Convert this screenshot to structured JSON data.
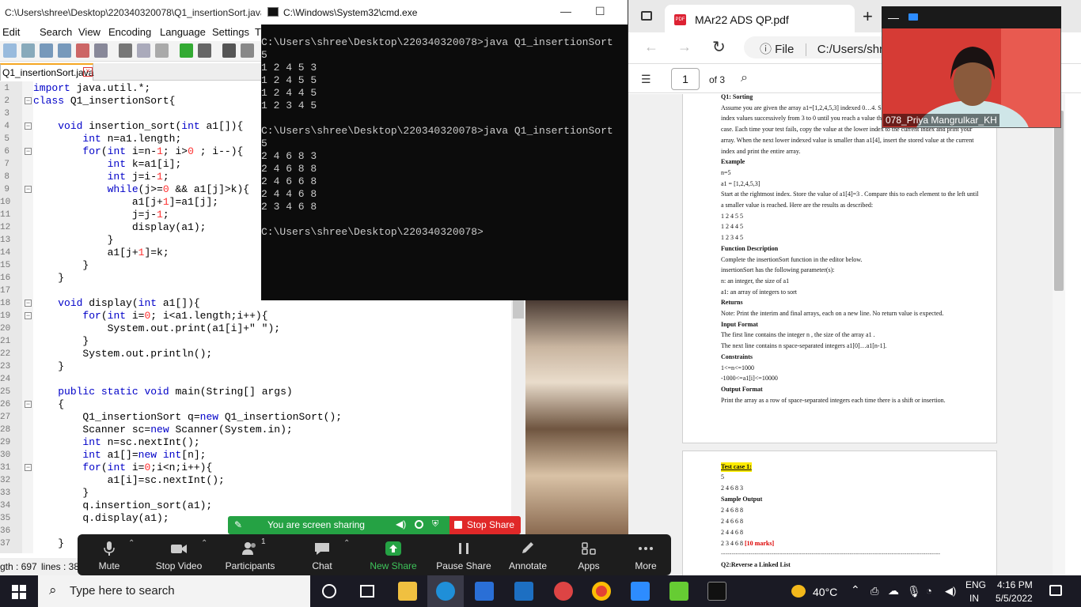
{
  "npp": {
    "title": "C:\\Users\\shree\\Desktop\\220340320078\\Q1_insertionSort.java",
    "menu": [
      "Edit",
      "Search",
      "View",
      "Encoding",
      "Language",
      "Settings",
      "T"
    ],
    "tab_label": "Q1_insertionSort.java",
    "line_numbers": [
      "1",
      "2",
      "3",
      "4",
      "5",
      "6",
      "7",
      "8",
      "9",
      "10",
      "11",
      "12",
      "13",
      "14",
      "15",
      "16",
      "17",
      "18",
      "19",
      "20",
      "21",
      "22",
      "23",
      "24",
      "25",
      "26",
      "27",
      "28",
      "29",
      "30",
      "31",
      "32",
      "33",
      "34",
      "35",
      "36",
      "37"
    ],
    "code": [
      "import java.util.*;",
      "class Q1_insertionSort{",
      "",
      "    void insertion_sort(int a1[]){",
      "        int n=a1.length;",
      "        for(int i=n-1; i>0 ; i--){",
      "            int k=a1[i];",
      "            int j=i-1;",
      "            while(j>=0 && a1[j]>k){",
      "                a1[j+1]=a1[j];",
      "                j=j-1;",
      "                display(a1);",
      "            }",
      "            a1[j+1]=k;",
      "        }",
      "    }",
      "",
      "    void display(int a1[]){",
      "        for(int i=0; i<a1.length;i++){",
      "            System.out.print(a1[i]+\" \");",
      "        }",
      "        System.out.println();",
      "    }",
      "",
      "    public static void main(String[] args)",
      "    {",
      "        Q1_insertionSort q=new Q1_insertionSort();",
      "        Scanner sc=new Scanner(System.in);",
      "        int n=sc.nextInt();",
      "        int a1[]=new int[n];",
      "        for(int i=0;i<n;i++){",
      "            a1[i]=sc.nextInt();",
      "        }",
      "        q.insertion_sort(a1);",
      "        q.display(a1);",
      "",
      "    }"
    ],
    "status_length": "gth : 697",
    "status_lines": "lines : 38"
  },
  "cmd": {
    "title": "C:\\Windows\\System32\\cmd.exe",
    "lines": [
      "C:\\Users\\shree\\Desktop\\220340320078>java Q1_insertionSort",
      "5",
      "1 2 4 5 3",
      "1 2 4 5 5",
      "1 2 4 4 5",
      "1 2 3 4 5",
      "",
      "C:\\Users\\shree\\Desktop\\220340320078>java Q1_insertionSort",
      "5",
      "2 4 6 8 3",
      "2 4 6 8 8",
      "2 4 6 6 8",
      "2 4 4 6 8",
      "2 3 4 6 8",
      "",
      "C:\\Users\\shree\\Desktop\\220340320078>"
    ]
  },
  "browser": {
    "tab_title": "MAr22 ADS QP.pdf",
    "pdf_badge": "PDF",
    "address_prefix": "File",
    "address": "C:/Users/shree",
    "page_current": "1",
    "page_total": "of 3"
  },
  "pdf_page1": [
    {
      "t": "Q1: Sorting",
      "b": true
    },
    {
      "t": "Assume you are given the array a1=[1,2,4,5,3] indexed 0…4. S",
      "b": false
    },
    {
      "t": "index values successively from 3 to 0 until you reach a value th",
      "b": false
    },
    {
      "t": "case. Each time your test fails, copy the value at the lower index to the current index and print your",
      "b": false
    },
    {
      "t": "array. When the next lower indexed value is smaller than a1[4], insert the stored value at the current",
      "b": false
    },
    {
      "t": "index and print the entire array.",
      "b": false
    },
    {
      "t": "Example",
      "b": true
    },
    {
      "t": "n=5",
      "b": false
    },
    {
      "t": "a1 = [1,2,4,5,3]",
      "b": false
    },
    {
      "t": "Start at the rightmost index. Store the value of a1[4]=3 . Compare this to each element to the left until",
      "b": false
    },
    {
      "t": "a smaller value is reached. Here are the results as described:",
      "b": false
    },
    {
      "t": "1 2 4 5 5",
      "b": false
    },
    {
      "t": "1 2 4 4 5",
      "b": false
    },
    {
      "t": "1 2 3 4 5",
      "b": false
    },
    {
      "t": "Function Description",
      "b": true
    },
    {
      "t": "Complete the insertionSort function in the editor below.",
      "b": false
    },
    {
      "t": "insertionSort has the following parameter(s):",
      "b": false
    },
    {
      "t": "n: an integer, the size of a1",
      "b": false
    },
    {
      "t": "a1: an array of integers to sort",
      "b": false
    },
    {
      "t": "Returns",
      "b": true
    },
    {
      "t": "Note: Print the interim and final arrays, each on a new line. No return value is expected.",
      "b": false
    },
    {
      "t": "Input Format",
      "b": true
    },
    {
      "t": "The first line contains the integer n , the size of the array a1 .",
      "b": false
    },
    {
      "t": "The next line contains n space-separated integers a1[0]…a1[n-1].",
      "b": false
    },
    {
      "t": "Constraints",
      "b": true
    },
    {
      "t": "1<=n<=1000",
      "b": false
    },
    {
      "t": "-1000<=a1[i]<=10000",
      "b": false
    },
    {
      "t": "Output Format",
      "b": true
    },
    {
      "t": "Print the array as a row of space-separated integers each time there is a shift or insertion.",
      "b": false
    }
  ],
  "pdf_page2": {
    "testcase": "Test case 1:",
    "lines": [
      "5",
      "2 4 6 8 3"
    ],
    "sample_output": "Sample Output",
    "outputs": [
      "2 4 6 8 8",
      "2 4 6 6 8",
      "2 4 4 6 8"
    ],
    "last_output": "2 3 4 6 8",
    "marks": "[10 marks]",
    "divider": "--------------------------------------------------------------------------------------------------------",
    "q2": "Q2:Reverse a Linked List"
  },
  "video": {
    "participant": "078_Priya Mangrulkar_KH"
  },
  "zoom": {
    "sharing_text": "You are screen sharing",
    "stop_share": "Stop Share",
    "participants_count": "1",
    "buttons": [
      {
        "label": "Mute",
        "icon": "microphone-icon"
      },
      {
        "label": "Stop Video",
        "icon": "camera-icon"
      },
      {
        "label": "Participants",
        "icon": "participants-icon"
      },
      {
        "label": "Chat",
        "icon": "chat-icon"
      },
      {
        "label": "New Share",
        "icon": "share-arrow-icon"
      },
      {
        "label": "Pause Share",
        "icon": "pause-icon"
      },
      {
        "label": "Annotate",
        "icon": "pencil-icon"
      },
      {
        "label": "Apps",
        "icon": "apps-icon"
      },
      {
        "label": "More",
        "icon": "more-dots-icon"
      }
    ],
    "green": "#25a244",
    "red": "#e02828"
  },
  "taskbar": {
    "search_placeholder": "Type here to search",
    "weather": "40°C",
    "lang1": "ENG",
    "lang2": "IN",
    "time": "4:16 PM",
    "date": "5/5/2022"
  }
}
